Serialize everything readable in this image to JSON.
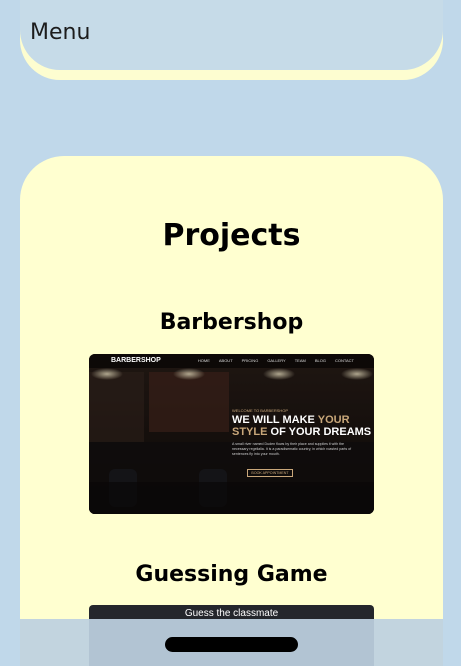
{
  "menu": {
    "label": "Menu"
  },
  "projects": {
    "title": "Projects",
    "items": [
      {
        "title": "Barbershop",
        "preview": {
          "brand": "BARBERSHOP",
          "nav_links": [
            "HOME",
            "ABOUT",
            "PRICING",
            "GALLERY",
            "TEAM",
            "BLOG",
            "CONTACT"
          ],
          "kicker": "WELCOME TO BARBERSHOP",
          "headline_line1_a": "WE WILL MAKE ",
          "headline_line1_b": "YOUR",
          "headline_line2_a": "STYLE",
          "headline_line2_b": " OF YOUR DREAMS",
          "body": "A small river named Duden flows by their place and supplies it with the necessary regelialia. It is a paradisematic country, in which roasted parts of sentences fly into your mouth.",
          "button": "BOOK APPOINTMENT"
        }
      },
      {
        "title": "Guessing Game",
        "preview": {
          "title": "Guess the classmate"
        }
      }
    ]
  },
  "colors": {
    "page_bg": "#c0d8ea",
    "card_bg": "#ffffd0",
    "accent_gold": "#c9a77a"
  }
}
